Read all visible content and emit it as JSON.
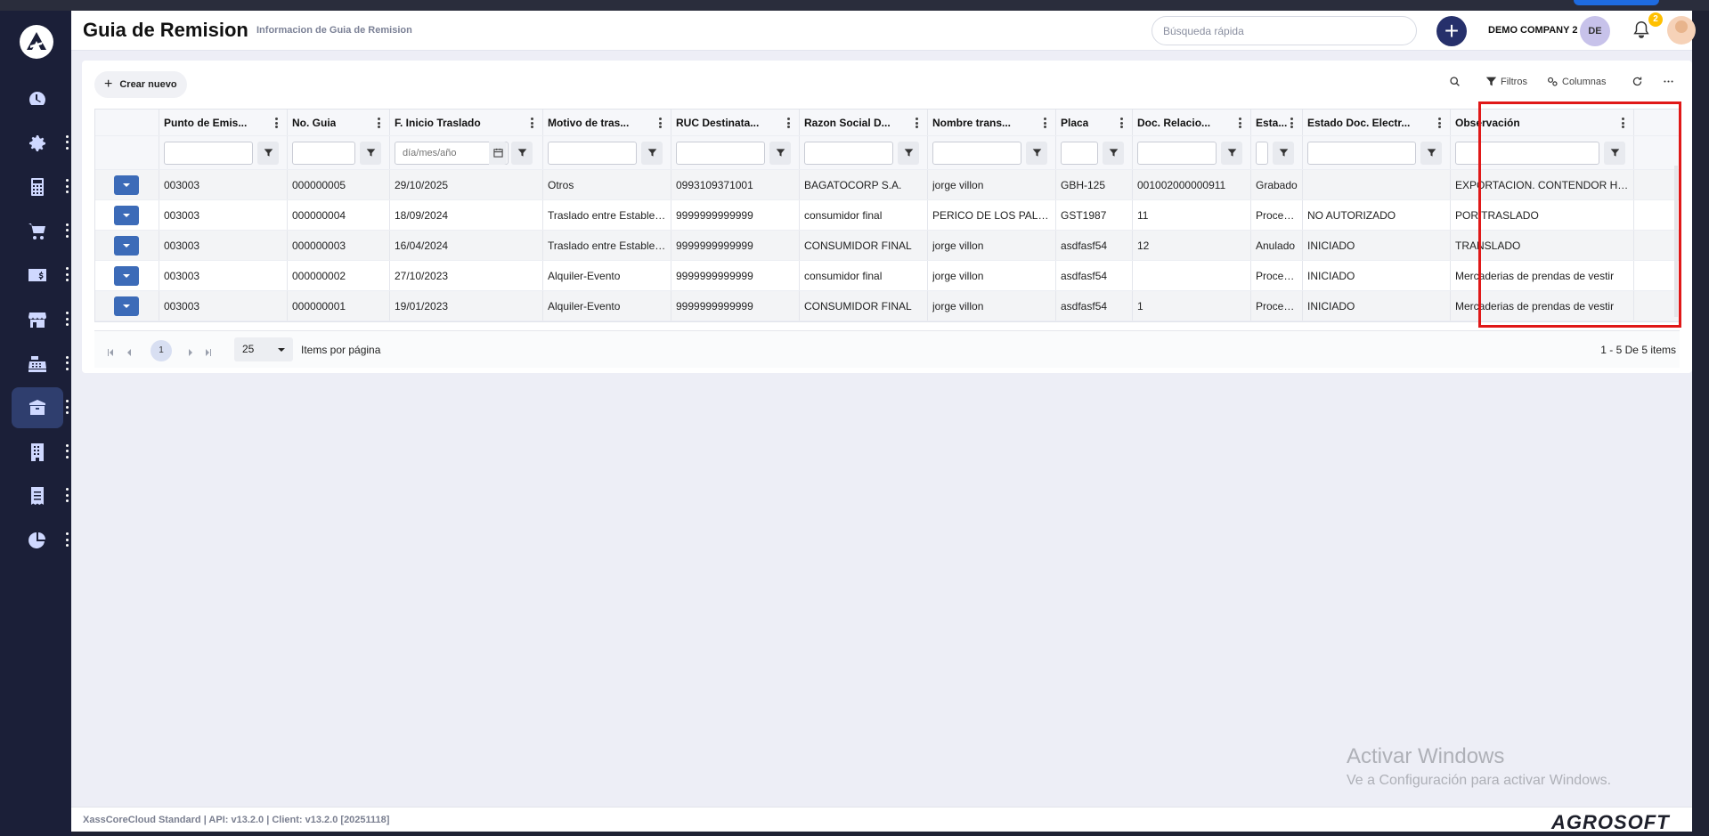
{
  "header": {
    "title": "Guia de Remision",
    "subtitle": "Informacion de Guia de Remision",
    "search_placeholder": "Búsqueda rápida",
    "company": "DEMO COMPANY 2",
    "company_initials": "DE",
    "notification_count": "2"
  },
  "sidebar": {
    "items": [
      {
        "icon": "dashboard-icon",
        "active": false
      },
      {
        "icon": "gear-icon",
        "active": false
      },
      {
        "icon": "calculator-icon",
        "active": false
      },
      {
        "icon": "cart-icon",
        "active": false
      },
      {
        "icon": "money-card-icon",
        "active": false
      },
      {
        "icon": "store-icon",
        "active": false
      },
      {
        "icon": "cash-register-icon",
        "active": false
      },
      {
        "icon": "box-icon",
        "active": true
      },
      {
        "icon": "building-icon",
        "active": false
      },
      {
        "icon": "receipt-icon",
        "active": false
      },
      {
        "icon": "pie-chart-icon",
        "active": false
      }
    ]
  },
  "toolbar": {
    "create_label": "Crear nuevo",
    "filters_label": "Filtros",
    "columns_label": "Columnas"
  },
  "grid": {
    "columns": [
      "Punto de Emis...",
      "No. Guia",
      "F. Inicio Traslado",
      "Motivo de tras...",
      "RUC Destinata...",
      "Razon Social D...",
      "Nombre trans...",
      "Placa",
      "Doc. Relacio...",
      "Esta...",
      "Estado Doc. Electr...",
      "Observación"
    ],
    "date_placeholder": "día/mes/año",
    "rows": [
      [
        "003003",
        "000000005",
        "29/10/2025",
        "Otros",
        "0993109371001",
        "BAGATOCORP S.A.",
        "jorge villon",
        "GBH-125",
        "001002000000911",
        "Grabado",
        "",
        "EXPORTACION. CONTENDOR HLB..."
      ],
      [
        "003003",
        "000000004",
        "18/09/2024",
        "Traslado entre Establec...",
        "9999999999999",
        "consumidor final",
        "PERICO DE LOS PALO...",
        "GST1987",
        "11",
        "Procesado",
        "NO AUTORIZADO",
        "POR TRASLADO"
      ],
      [
        "003003",
        "000000003",
        "16/04/2024",
        "Traslado entre Establec...",
        "9999999999999",
        "CONSUMIDOR FINAL",
        "jorge villon",
        "asdfasf54",
        "12",
        "Anulado",
        "INICIADO",
        "TRANSLADO"
      ],
      [
        "003003",
        "000000002",
        "27/10/2023",
        "Alquiler-Evento",
        "9999999999999",
        "consumidor final",
        "jorge villon",
        "asdfasf54",
        "",
        "Procesado",
        "INICIADO",
        "Mercaderias de prendas de vestir"
      ],
      [
        "003003",
        "000000001",
        "19/01/2023",
        "Alquiler-Evento",
        "9999999999999",
        "CONSUMIDOR FINAL",
        "jorge villon",
        "asdfasf54",
        "1",
        "Procesado",
        "INICIADO",
        "Mercaderias de prendas de vestir"
      ]
    ]
  },
  "pager": {
    "current_page": "1",
    "page_size": "25",
    "page_size_label": "Items por página",
    "info": "1 - 5 De 5 items"
  },
  "watermark": {
    "line1": "Activar Windows",
    "line2": "Ve a Configuración para activar Windows."
  },
  "footer": {
    "version": "XassCoreCloud Standard | API: v13.2.0 | Client: v13.2.0 [20251118]",
    "brand": "AGROSOFT"
  },
  "colors": {
    "sidebar_bg": "#1b1f38",
    "primary": "#26306b",
    "action_button": "#3c6bb8",
    "highlight_border": "#e01818"
  }
}
